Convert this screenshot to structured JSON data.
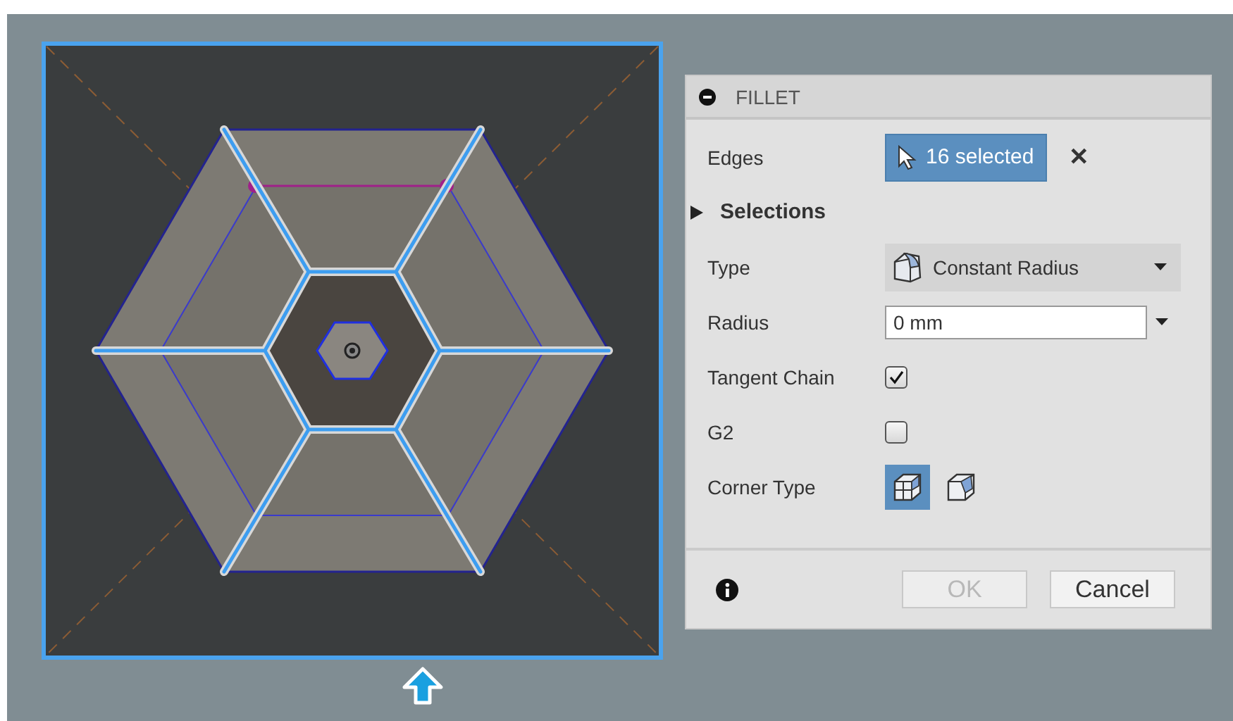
{
  "panel": {
    "title": "FILLET",
    "rows": [
      {
        "kind": "selection",
        "label": "Edges",
        "value": "16 selected",
        "clear": "✕"
      },
      {
        "kind": "section",
        "label": "Selections",
        "expanded": false
      },
      {
        "kind": "dropdown",
        "label": "Type",
        "value": "Constant Radius"
      },
      {
        "kind": "input",
        "label": "Radius",
        "value": "0 mm"
      },
      {
        "kind": "checkbox",
        "label": "Tangent Chain",
        "checked": true
      },
      {
        "kind": "checkbox",
        "label": "G2",
        "checked": false
      },
      {
        "kind": "corner",
        "label": "Corner Type",
        "options": [
          {
            "selected": true
          },
          {
            "selected": false
          }
        ]
      }
    ],
    "buttons": [
      {
        "label": "OK",
        "disabled": true
      },
      {
        "label": "Cancel",
        "disabled": false
      }
    ]
  }
}
